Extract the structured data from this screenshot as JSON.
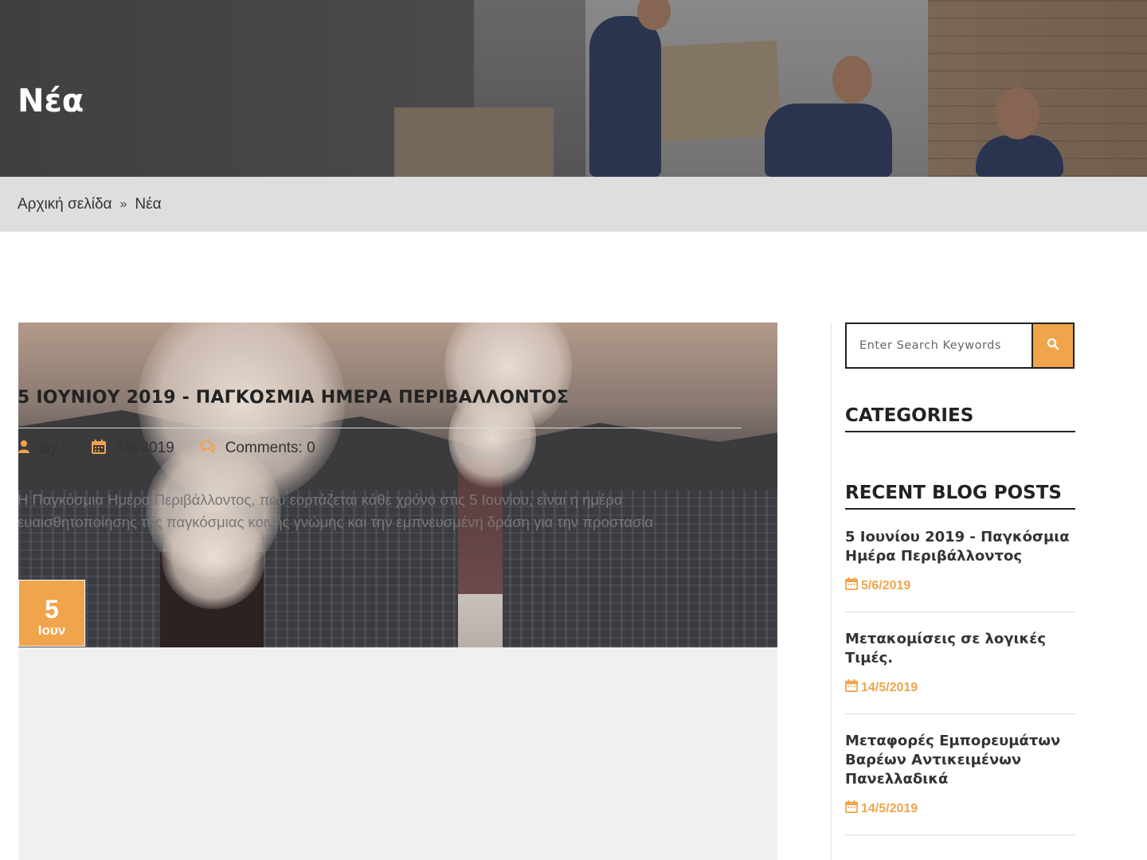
{
  "hero": {
    "title": "Νέα"
  },
  "breadcrumb": {
    "home": "Αρχική σελίδα",
    "separator": "»",
    "current": "Νέα"
  },
  "post": {
    "date_day": "5",
    "date_month": "Ιουν",
    "title": "5 ΙΟΥΝΙΟΥ 2019 - ΠΑΓΚΟΣΜΙΑ ΗΜΕΡΑ ΠΕΡΙΒΑΛΛΟΝΤΟΣ",
    "meta": {
      "by_label": "By :",
      "date": "5/6/2019",
      "comments": "Comments: 0"
    },
    "excerpt": "Η Παγκόσμια Ημέρα Περιβάλλοντος, που εορτάζεται κάθε χρόνο στις 5 Ιουνίου, είναι η ημέρα ευαισθητοποίησης της παγκόσμιας κοινής γνώμης και την εμπνευσμένη δράση για την προστασία"
  },
  "sidebar": {
    "search": {
      "placeholder": "Enter Search Keywords",
      "icon": "search-icon"
    },
    "categories_title": "CATEGORIES",
    "recent_title": "RECENT BLOG POSTS",
    "recent_posts": [
      {
        "title": "5 Ιουνίου 2019 - Παγκόσμια Ημέρα Περιβάλλοντος",
        "date": "5/6/2019"
      },
      {
        "title": "Μετακομίσεις σε λογικές Τιμές.",
        "date": "14/5/2019"
      },
      {
        "title": "Μεταφορές Εμπορευμάτων Βαρέων Αντικειμένων Πανελλαδικά",
        "date": "14/5/2019"
      }
    ]
  },
  "colors": {
    "accent": "#f0a44b",
    "breadcrumb_bg": "#dedede",
    "post_bg": "#f0f0f0"
  }
}
